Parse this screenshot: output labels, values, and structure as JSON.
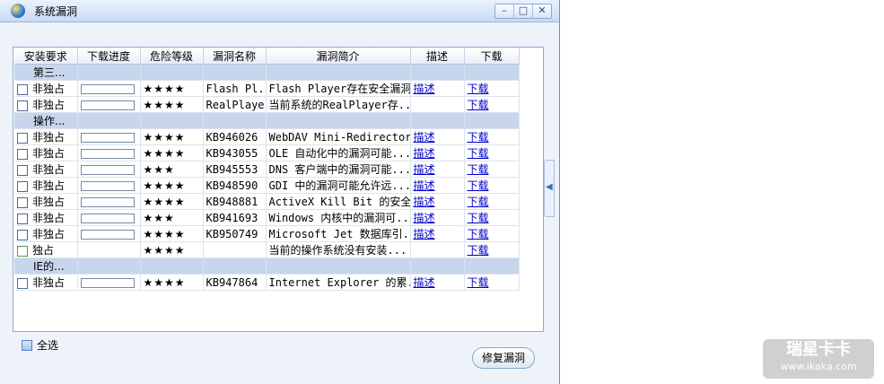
{
  "window": {
    "title": "系统漏洞",
    "controls": {
      "minimize": "–",
      "maximize": "□",
      "close": "✕"
    }
  },
  "table": {
    "headers": [
      "安装要求",
      "下载进度",
      "危险等级",
      "漏洞名称",
      "漏洞简介",
      "描述",
      "下载"
    ],
    "rows": [
      {
        "type": "group",
        "label": "第三..."
      },
      {
        "type": "item",
        "checkbox": true,
        "requirement": "非独占",
        "progress": 0,
        "stars": "★★★★",
        "name": "Flash Pl...",
        "intro": "Flash Player存在安全漏洞",
        "describe": "描述",
        "download": "下载"
      },
      {
        "type": "item",
        "checkbox": true,
        "requirement": "非独占",
        "progress": 0,
        "stars": "★★★★",
        "name": "RealPlayer",
        "intro": "当前系统的RealPlayer存...",
        "describe": "",
        "download": "下载"
      },
      {
        "type": "group",
        "label": "操作..."
      },
      {
        "type": "item",
        "checkbox": true,
        "requirement": "非独占",
        "progress": 0,
        "stars": "★★★★",
        "name": "KB946026",
        "intro": "WebDAV Mini-Redirector ...",
        "describe": "描述",
        "download": "下载"
      },
      {
        "type": "item",
        "checkbox": true,
        "requirement": "非独占",
        "progress": 0,
        "stars": "★★★★",
        "name": "KB943055",
        "intro": "OLE 自动化中的漏洞可能...",
        "describe": "描述",
        "download": "下载"
      },
      {
        "type": "item",
        "checkbox": true,
        "requirement": "非独占",
        "progress": 0,
        "stars": "★★★",
        "name": "KB945553",
        "intro": "DNS 客户端中的漏洞可能...",
        "describe": "描述",
        "download": "下载"
      },
      {
        "type": "item",
        "checkbox": true,
        "requirement": "非独占",
        "progress": 0,
        "stars": "★★★★",
        "name": "KB948590",
        "intro": "GDI 中的漏洞可能允许远...",
        "describe": "描述",
        "download": "下载"
      },
      {
        "type": "item",
        "checkbox": true,
        "requirement": "非独占",
        "progress": 0,
        "stars": "★★★★",
        "name": "KB948881",
        "intro": "ActiveX Kill Bit 的安全...",
        "describe": "描述",
        "download": "下载"
      },
      {
        "type": "item",
        "checkbox": true,
        "requirement": "非独占",
        "progress": 0,
        "stars": "★★★",
        "name": "KB941693",
        "intro": "Windows 内核中的漏洞可...",
        "describe": "描述",
        "download": "下载"
      },
      {
        "type": "item",
        "checkbox": true,
        "requirement": "非独占",
        "progress": 0,
        "stars": "★★★★",
        "name": "KB950749",
        "intro": "Microsoft Jet 数据库引...",
        "describe": "描述",
        "download": "下载"
      },
      {
        "type": "item",
        "checkbox": true,
        "checkbox_color": "green",
        "requirement": "独占",
        "progress": null,
        "stars": "★★★★",
        "name": "",
        "intro": "当前的操作系统没有安装...",
        "describe": "",
        "download": "下载"
      },
      {
        "type": "group",
        "label": "IE的..."
      },
      {
        "type": "item",
        "checkbox": true,
        "requirement": "非独占",
        "progress": 0,
        "stars": "★★★★",
        "name": "KB947864",
        "intro": "Internet Explorer 的累...",
        "describe": "描述",
        "download": "下载"
      }
    ]
  },
  "footer": {
    "select_all_label": "全选",
    "repair_button": "修复漏洞"
  },
  "watermark": {
    "brand": "瑞星卡卡",
    "url": "www.ikaka.com"
  },
  "colors": {
    "accent": "#2f7bd6",
    "link": "#0000cc",
    "group_row": "#c7d6ec"
  }
}
